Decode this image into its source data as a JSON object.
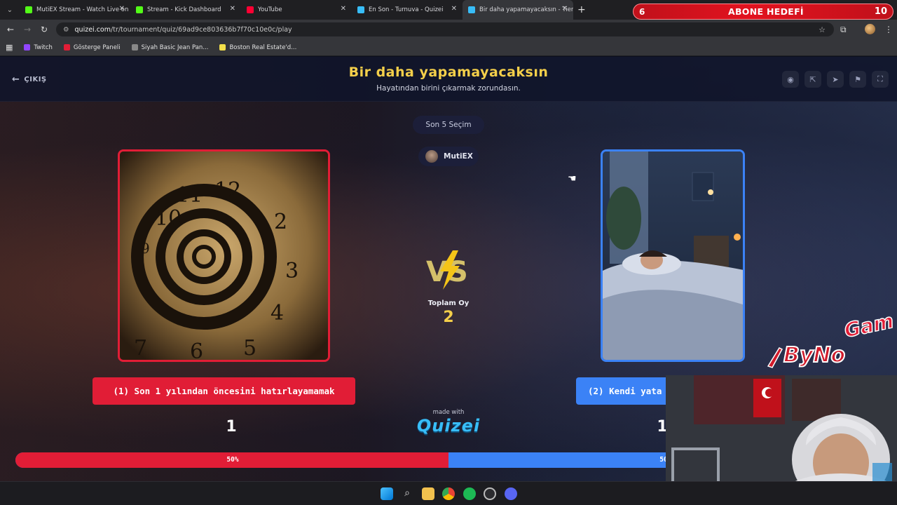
{
  "browser": {
    "tabs": [
      {
        "label": "MutiEX Stream - Watch Live on",
        "favicon_color": "#53fc18"
      },
      {
        "label": "Stream - Kick Dashboard",
        "favicon_color": "#53fc18"
      },
      {
        "label": "YouTube",
        "favicon_color": "#ff0033"
      },
      {
        "label": "En Son - Turnuva - Quizei",
        "favicon_color": "#38bdf8"
      },
      {
        "label": "Bir daha yapamayacaksın - Tier",
        "favicon_color": "#38bdf8"
      }
    ],
    "url_host": "quizei.com",
    "url_path": "/tr/tournament/quiz/69ad9ce803636b7f70c10e0c/play",
    "bookmarks": [
      {
        "label": "Twitch",
        "favicon_color": "#9146ff"
      },
      {
        "label": "Gösterge Paneli",
        "favicon_color": "#e11d36"
      },
      {
        "label": "Siyah Basic Jean Pan...",
        "favicon_color": "#888888"
      },
      {
        "label": "Boston Real Estate'd...",
        "favicon_color": "#f4e04a"
      }
    ]
  },
  "overlay": {
    "abone_left": "6",
    "abone_label": "ABONE HEDEFİ",
    "abone_right": "10",
    "byno_text": "ByNo",
    "gam_text": "Gam"
  },
  "page": {
    "exit_label": "ÇIKIŞ",
    "title": "Bir daha yapamayacaksın",
    "subtitle": "Hayatından birini çıkarmak zorundasın.",
    "round_pill": "Son 5 Seçim",
    "username": "MutiEX",
    "vs_text": "VS",
    "total_label": "Toplam Oy",
    "total_value": "2",
    "made_with": "made with",
    "brand": "Quizei"
  },
  "options": {
    "left": {
      "label": "(1) Son 1 yılından öncesini hatırlayamamak",
      "votes": "1",
      "percent_label": "50%",
      "share": 0.5,
      "color": "#e11d36"
    },
    "right": {
      "label": "(2) Kendi yata",
      "votes": "1",
      "percent_label": "50",
      "share": 0.5,
      "color": "#3b82f6"
    }
  },
  "colors": {
    "accent_title": "#f4cf4a",
    "left": "#e11d36",
    "right": "#3b82f6"
  }
}
